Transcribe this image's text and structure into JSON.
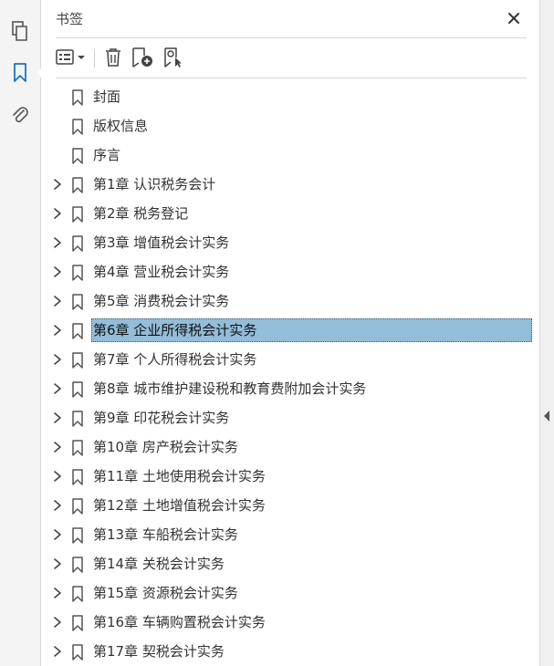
{
  "rail": {
    "items": [
      {
        "icon": "pages-icon"
      },
      {
        "icon": "bookmark-icon",
        "active": true
      },
      {
        "icon": "attachment-icon"
      }
    ]
  },
  "panel": {
    "title": "书签",
    "close_icon": "close-icon",
    "toolbar": {
      "options_icon": "bookmark-options-icon",
      "delete_icon": "delete-icon",
      "new_icon": "new-bookmark-icon",
      "find_icon": "find-bookmark-icon"
    }
  },
  "bookmarks": [
    {
      "label": "封面",
      "expandable": false
    },
    {
      "label": "版权信息",
      "expandable": false
    },
    {
      "label": "序言",
      "expandable": false
    },
    {
      "label": "第1章 认识税务会计",
      "expandable": true
    },
    {
      "label": "第2章 税务登记",
      "expandable": true
    },
    {
      "label": "第3章 增值税会计实务",
      "expandable": true
    },
    {
      "label": "第4章 营业税会计实务",
      "expandable": true
    },
    {
      "label": "第5章 消费税会计实务",
      "expandable": true
    },
    {
      "label": "第6章 企业所得税会计实务",
      "expandable": true,
      "selected": true
    },
    {
      "label": "第7章 个人所得税会计实务",
      "expandable": true
    },
    {
      "label": "第8章 城市维护建设税和教育费附加会计实务",
      "expandable": true
    },
    {
      "label": "第9章 印花税会计实务",
      "expandable": true
    },
    {
      "label": "第10章 房产税会计实务",
      "expandable": true
    },
    {
      "label": "第11章 土地使用税会计实务",
      "expandable": true
    },
    {
      "label": "第12章 土地增值税会计实务",
      "expandable": true
    },
    {
      "label": "第13章 车船税会计实务",
      "expandable": true
    },
    {
      "label": "第14章 关税会计实务",
      "expandable": true
    },
    {
      "label": "第15章 资源税会计实务",
      "expandable": true
    },
    {
      "label": "第16章 车辆购置税会计实务",
      "expandable": true
    },
    {
      "label": "第17章 契税会计实务",
      "expandable": true
    }
  ],
  "colors": {
    "selection": "#93bdd9",
    "accent": "#1a73c9"
  }
}
